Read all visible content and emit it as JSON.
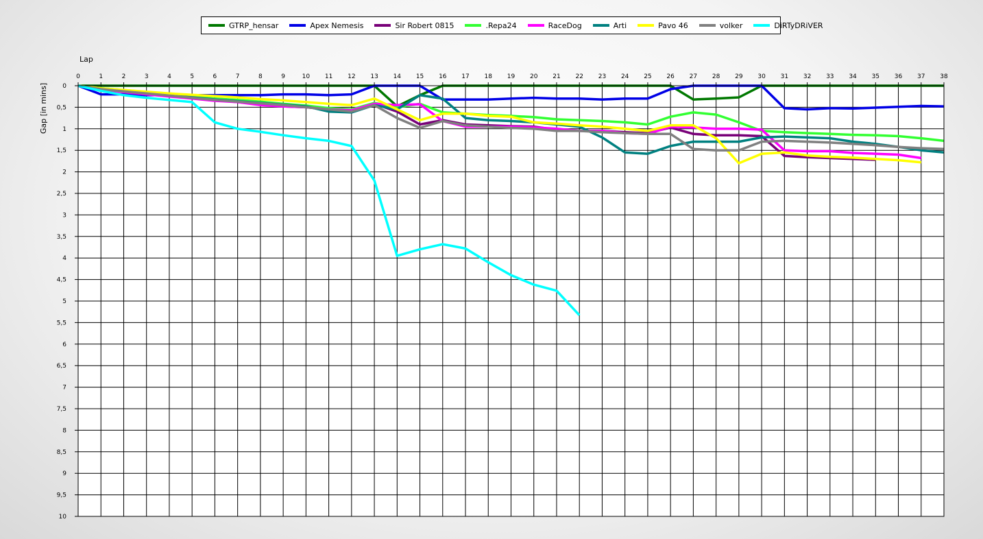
{
  "chart_data": {
    "type": "line",
    "xlabel": "Lap",
    "ylabel": "Gap [in mins]",
    "xlim": [
      0,
      38
    ],
    "ylim": [
      0,
      10
    ],
    "y_inverted": true,
    "x_ticks": [
      0,
      1,
      2,
      3,
      4,
      5,
      6,
      7,
      8,
      9,
      10,
      11,
      12,
      13,
      14,
      15,
      16,
      17,
      18,
      19,
      20,
      21,
      22,
      23,
      24,
      25,
      26,
      27,
      28,
      29,
      30,
      31,
      32,
      33,
      34,
      35,
      36,
      37,
      38
    ],
    "y_ticks": [
      {
        "value": 0,
        "label": "0"
      },
      {
        "value": 0.5,
        "label": "0,5"
      },
      {
        "value": 1,
        "label": "1"
      },
      {
        "value": 1.5,
        "label": "1,5"
      },
      {
        "value": 2,
        "label": "2"
      },
      {
        "value": 2.5,
        "label": "2,5"
      },
      {
        "value": 3,
        "label": "3"
      },
      {
        "value": 3.5,
        "label": "3,5"
      },
      {
        "value": 4,
        "label": "4"
      },
      {
        "value": 4.5,
        "label": "4,5"
      },
      {
        "value": 5,
        "label": "5"
      },
      {
        "value": 5.5,
        "label": "5,5"
      },
      {
        "value": 6,
        "label": "6"
      },
      {
        "value": 6.5,
        "label": "6,5"
      },
      {
        "value": 7,
        "label": "7"
      },
      {
        "value": 7.5,
        "label": "7,5"
      },
      {
        "value": 8,
        "label": "8"
      },
      {
        "value": 8.5,
        "label": "8,5"
      },
      {
        "value": 9,
        "label": "9"
      },
      {
        "value": 9.5,
        "label": "9,5"
      },
      {
        "value": 10,
        "label": "10"
      }
    ],
    "grid": true,
    "legend_position": "top-center",
    "series": [
      {
        "name": "GTRP_hensar",
        "color": "#007800",
        "values": [
          0,
          0,
          0,
          0,
          0,
          0,
          0,
          0,
          0,
          0,
          0,
          0,
          0,
          0,
          0.48,
          0.22,
          0,
          0,
          0,
          0,
          0,
          0,
          0,
          0,
          0,
          0,
          0,
          0.32,
          0.3,
          0.27,
          0,
          0,
          0,
          0,
          0,
          0,
          0,
          0,
          0
        ]
      },
      {
        "name": "Apex Nemesis",
        "color": "#0000e6",
        "values": [
          0,
          0.2,
          0.2,
          0.22,
          0.22,
          0.22,
          0.22,
          0.22,
          0.22,
          0.2,
          0.2,
          0.22,
          0.2,
          0,
          0,
          0,
          0.32,
          0.32,
          0.32,
          0.3,
          0.28,
          0.3,
          0.3,
          0.32,
          0.3,
          0.3,
          0.08,
          0,
          0,
          0,
          0,
          0.52,
          0.55,
          0.52,
          0.53,
          0.51,
          0.49,
          0.47,
          0.48
        ]
      },
      {
        "name": "Sir Robert 0815",
        "color": "#780078",
        "values": [
          0,
          0.08,
          0.13,
          0.18,
          0.23,
          0.28,
          0.33,
          0.38,
          0.43,
          0.48,
          0.5,
          0.55,
          0.58,
          0.42,
          0.6,
          0.9,
          0.8,
          0.9,
          0.92,
          0.94,
          0.95,
          1.02,
          1.05,
          1.05,
          1.08,
          1.1,
          0.97,
          1.12,
          1.15,
          1.15,
          1.17,
          1.63,
          1.66,
          1.68,
          1.7,
          1.72,
          null,
          null,
          null
        ]
      },
      {
        "name": ".Repa24",
        "color": "#32ff32",
        "values": [
          0,
          0.06,
          0.1,
          0.15,
          0.2,
          0.25,
          0.3,
          0.33,
          0.37,
          0.42,
          0.46,
          0.52,
          0.55,
          0.4,
          0.5,
          0.42,
          0.62,
          0.65,
          0.68,
          0.7,
          0.73,
          0.78,
          0.8,
          0.82,
          0.85,
          0.9,
          0.72,
          0.62,
          0.67,
          0.85,
          1.05,
          1.08,
          1.1,
          1.12,
          1.14,
          1.15,
          1.17,
          1.22,
          1.28
        ]
      },
      {
        "name": "RaceDog",
        "color": "#ff00ff",
        "values": [
          0,
          0.1,
          0.15,
          0.2,
          0.25,
          0.3,
          0.35,
          0.38,
          0.45,
          0.48,
          0.5,
          0.55,
          0.57,
          0.42,
          0.45,
          0.43,
          0.82,
          0.95,
          0.95,
          0.95,
          0.97,
          1.0,
          1.05,
          1.05,
          1.1,
          1.12,
          0.95,
          0.97,
          1.0,
          1.0,
          1.02,
          1.5,
          1.52,
          1.52,
          1.56,
          1.58,
          1.6,
          1.68,
          null
        ]
      },
      {
        "name": "Arti",
        "color": "#008080",
        "values": [
          0,
          0.08,
          0.13,
          0.18,
          0.22,
          0.27,
          0.32,
          0.36,
          0.4,
          0.44,
          0.48,
          0.6,
          0.62,
          0.45,
          0.55,
          0.22,
          0.3,
          0.75,
          0.8,
          0.82,
          0.85,
          0.9,
          0.95,
          1.2,
          1.55,
          1.58,
          1.4,
          1.3,
          1.3,
          1.3,
          1.2,
          1.18,
          1.2,
          1.22,
          1.3,
          1.35,
          1.42,
          1.5,
          1.55
        ]
      },
      {
        "name": "Pavo 46",
        "color": "#ffff00",
        "values": [
          0,
          0.06,
          0.1,
          0.14,
          0.18,
          0.21,
          0.24,
          0.27,
          0.31,
          0.34,
          0.38,
          0.42,
          0.45,
          0.3,
          0.55,
          0.8,
          0.65,
          0.65,
          0.7,
          0.72,
          0.85,
          0.88,
          0.92,
          0.95,
          1.0,
          1.05,
          0.92,
          0.92,
          1.22,
          1.8,
          1.58,
          1.55,
          1.62,
          1.65,
          1.67,
          1.7,
          1.73,
          1.78,
          null
        ]
      },
      {
        "name": "volker",
        "color": "#808080",
        "values": [
          0,
          0.08,
          0.13,
          0.18,
          0.23,
          0.28,
          0.33,
          0.37,
          0.41,
          0.45,
          0.5,
          0.55,
          0.6,
          0.45,
          0.75,
          0.98,
          0.82,
          0.92,
          0.95,
          0.98,
          1.0,
          1.05,
          1.05,
          1.08,
          1.1,
          1.12,
          1.12,
          1.47,
          1.5,
          1.5,
          1.3,
          1.28,
          1.3,
          1.32,
          1.35,
          1.38,
          1.42,
          1.45,
          1.47
        ]
      },
      {
        "name": "DiRTyDRiVER",
        "color": "#00ffff",
        "values": [
          0,
          0.12,
          0.22,
          0.28,
          0.33,
          0.38,
          0.85,
          1.0,
          1.07,
          1.15,
          1.22,
          1.28,
          1.4,
          2.2,
          3.95,
          3.8,
          3.68,
          3.78,
          4.1,
          4.4,
          4.62,
          4.76,
          5.33,
          null,
          null,
          null,
          null,
          null,
          null,
          null,
          null,
          null,
          null,
          null,
          null,
          null,
          null,
          null,
          null
        ]
      }
    ]
  }
}
